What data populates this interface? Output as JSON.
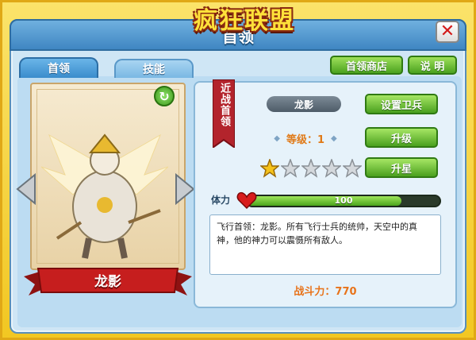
{
  "app": {
    "logo": "疯狂联盟",
    "title": "首领"
  },
  "tabs": [
    {
      "label": "首领",
      "active": true
    },
    {
      "label": "技能",
      "active": false
    }
  ],
  "header_buttons": {
    "shop": "首领商店",
    "help": "说 明"
  },
  "hero": {
    "name": "龙影",
    "rank_label": "近战首领",
    "level_label": "等级：1",
    "stars_filled": 1,
    "stars_total": 5,
    "hp_label": "体力",
    "hp_value": "100",
    "hp_fraction": 0.8,
    "description": "飞行首领：龙影。所有飞行士兵的统帅，天空中的真神，他的神力可以震慑所有敌人。",
    "power_label": "战斗力：770"
  },
  "actions": {
    "set_guard": "设置卫兵",
    "upgrade": "升级",
    "star_up": "升星"
  },
  "icons": {
    "close": "close-icon",
    "refresh": "refresh-icon",
    "prev": "arrow-left-icon",
    "next": "arrow-right-icon",
    "heart": "heart-icon",
    "star": "star-icon"
  },
  "colors": {
    "accent_green": "#4aa01e",
    "frame_yellow": "#f2c722",
    "panel_blue": "#3f86c2",
    "ribbon_red": "#c61e1e",
    "power_orange": "#e8731a"
  }
}
